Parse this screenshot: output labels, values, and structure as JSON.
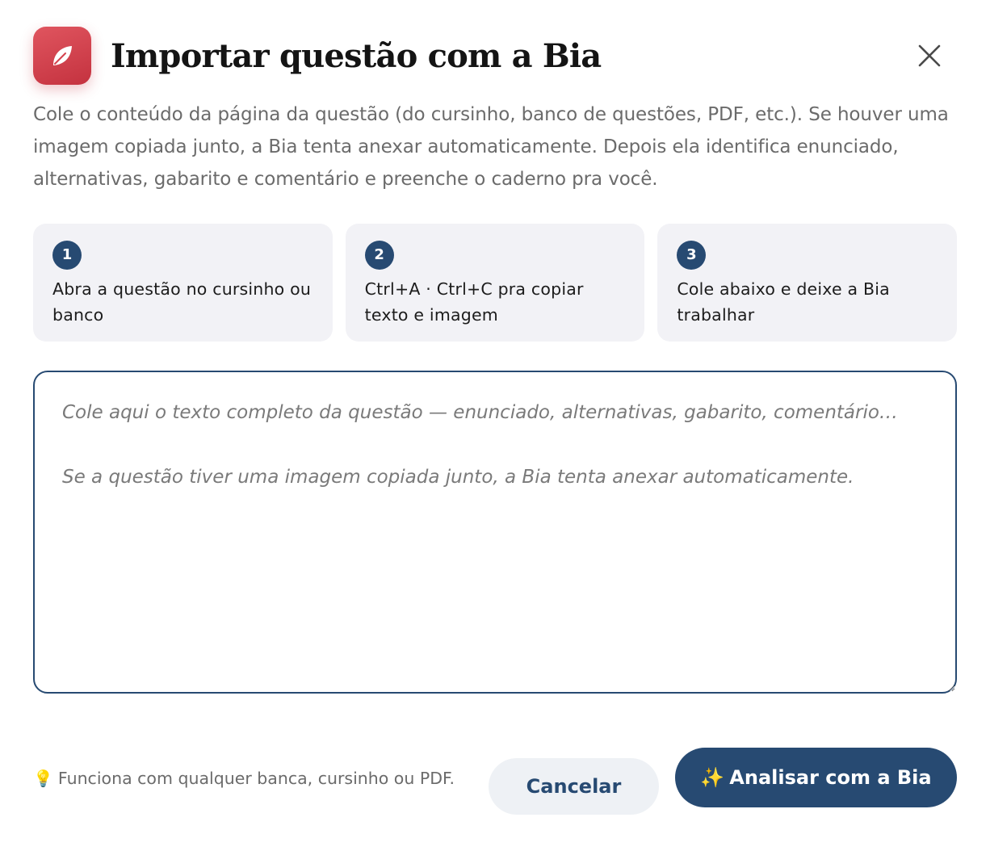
{
  "dialog": {
    "title": "Importar questão com a Bia",
    "logo_icon": "leaf-icon",
    "close_icon": "close-icon",
    "description": "Cole o conteúdo da página da questão (do cursinho, banco de questões, PDF, etc.). Se houver uma imagem copiada junto, a Bia tenta anexar automaticamente. Depois ela identifica enunciado, alternativas, gabarito e comentário e preenche o caderno pra você."
  },
  "steps": [
    {
      "number": "1",
      "text": "Abra a questão no cursinho ou banco"
    },
    {
      "number": "2",
      "text": "Ctrl+A · Ctrl+C pra copiar texto e imagem"
    },
    {
      "number": "3",
      "text": "Cole abaixo e deixe a Bia trabalhar"
    }
  ],
  "paste": {
    "value": "",
    "placeholder": "Cole aqui o texto completo da questão — enunciado, alternativas, gabarito, comentário…\n\nSe a questão tiver uma imagem copiada junto, a Bia tenta anexar automaticamente."
  },
  "footer": {
    "hint_icon": "lightbulb-icon",
    "hint_glyph": "💡",
    "hint": "Funciona com qualquer banca, cursinho ou PDF.",
    "cancel_label": "Cancelar",
    "analyze_icon": "sparkles-icon",
    "analyze_glyph": "✨",
    "analyze_label": "Analisar com a Bia"
  },
  "colors": {
    "brand_red": "#d4434e",
    "primary_navy": "#274a72",
    "step_bg": "#f2f2f6",
    "cancel_bg": "#eef1f5"
  }
}
